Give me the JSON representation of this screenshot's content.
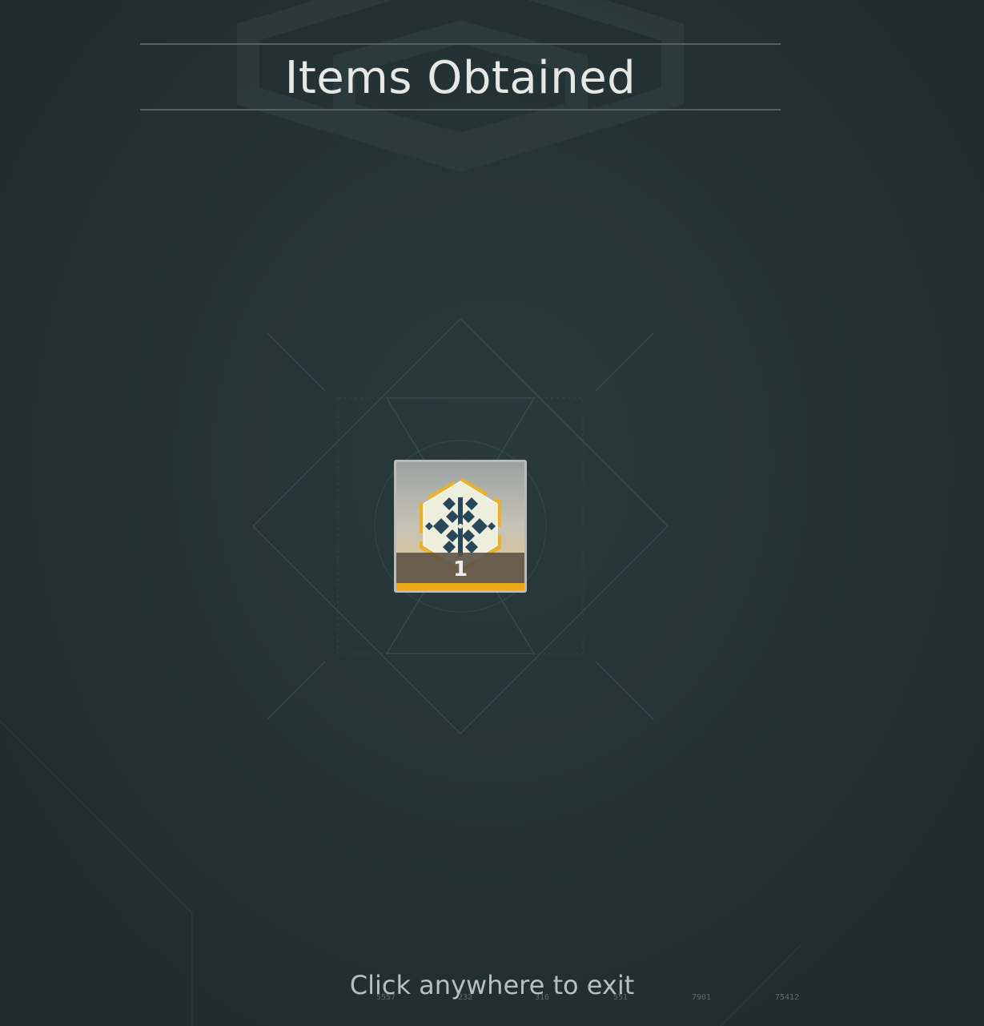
{
  "title": "Items Obtained",
  "item": {
    "quantity": "1",
    "icon": "snowflake-hexagon-emblem-icon",
    "rarity_color": "#e8a818"
  },
  "exit_hint": "Click anywhere to exit",
  "footer_codes": [
    "5557",
    "232",
    "316",
    "551",
    "7901",
    "75412"
  ],
  "colors": {
    "background": "#263436",
    "title": "#e6e8e5",
    "hint": "#b9bfbd",
    "accent": "#e8a818"
  }
}
